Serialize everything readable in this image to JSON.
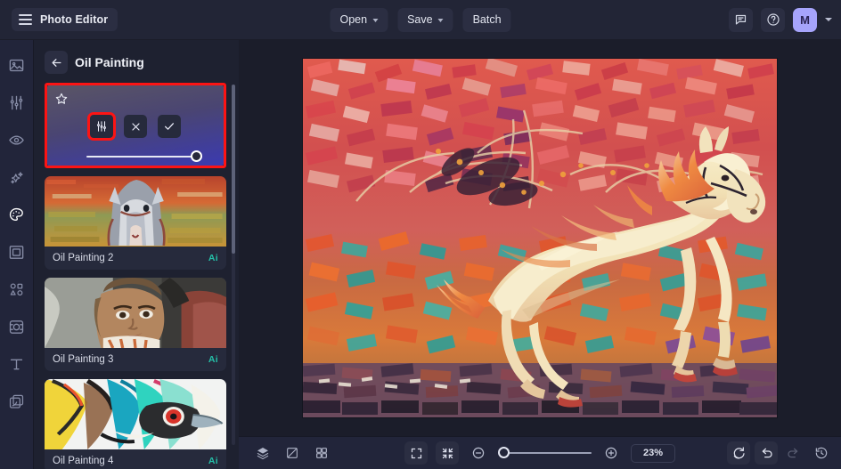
{
  "app": {
    "name": "Photo Editor",
    "menu_icon": "hamburger-icon"
  },
  "topbar": {
    "open_label": "Open",
    "save_label": "Save",
    "batch_label": "Batch",
    "feedback_icon": "chat-bubble-icon",
    "help_icon": "question-circle-icon",
    "avatar_initial": "M",
    "avatar_color": "#a6a4fb"
  },
  "rail": {
    "items": [
      {
        "icon": "image-icon",
        "name": "sidebar-item-image",
        "active": false
      },
      {
        "icon": "sliders-icon",
        "name": "sidebar-item-adjust",
        "active": false
      },
      {
        "icon": "eye-icon",
        "name": "sidebar-item-retouch",
        "active": false
      },
      {
        "icon": "sparkles-icon",
        "name": "sidebar-item-effects",
        "active": false
      },
      {
        "icon": "palette-icon",
        "name": "sidebar-item-art-styles",
        "active": true
      },
      {
        "icon": "frame-icon",
        "name": "sidebar-item-frames",
        "active": false
      },
      {
        "icon": "shapes-icon",
        "name": "sidebar-item-shapes",
        "active": false
      },
      {
        "icon": "mask-icon",
        "name": "sidebar-item-mask",
        "active": false
      },
      {
        "icon": "text-icon",
        "name": "sidebar-item-text",
        "active": false
      },
      {
        "icon": "layers-copy-icon",
        "name": "sidebar-item-layers",
        "active": false
      }
    ]
  },
  "panel": {
    "back_icon": "arrow-left-icon",
    "title": "Oil Painting",
    "active_card": {
      "star_icon": "star-outline-icon",
      "settings_icon": "sliders-icon",
      "close_icon": "close-x-icon",
      "apply_icon": "check-icon",
      "slider_value": 100,
      "highlight_color": "#fc1414"
    },
    "presets": [
      {
        "label": "Oil Painting 2",
        "badge": "Ai"
      },
      {
        "label": "Oil Painting 3",
        "badge": "Ai"
      },
      {
        "label": "Oil Painting 4",
        "badge": "Ai"
      }
    ]
  },
  "bottombar": {
    "layers_icon": "layers-icon",
    "compare_icon": "compare-split-icon",
    "grid_icon": "grid-icon",
    "fit_icon": "fit-screen-icon",
    "shrink_icon": "collapse-arrows-icon",
    "zoom_out_icon": "minus-circle-icon",
    "zoom_in_icon": "plus-circle-icon",
    "zoom_value": "23%",
    "zoom_slider_percent": 3,
    "reset_icon": "reset-icon",
    "undo_icon": "undo-arrow-icon",
    "redo_icon": "redo-arrow-icon",
    "history_icon": "history-clock-icon"
  },
  "canvas": {
    "image_description": "Oil painting style rendering of a galloping white horse on a vivid red, orange and teal painterly background"
  }
}
